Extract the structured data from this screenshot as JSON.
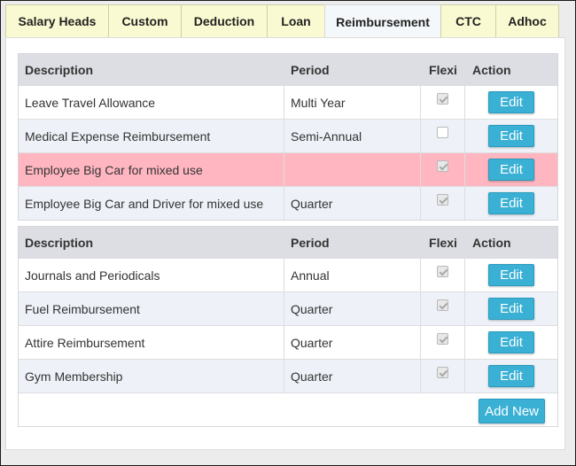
{
  "tabs": [
    {
      "label": "Salary Heads",
      "active": false
    },
    {
      "label": "Custom",
      "active": false
    },
    {
      "label": "Deduction",
      "active": false
    },
    {
      "label": "Loan",
      "active": false
    },
    {
      "label": "Reimbursement",
      "active": true
    },
    {
      "label": "CTC",
      "active": false
    },
    {
      "label": "Adhoc",
      "active": false
    }
  ],
  "tables": [
    {
      "headers": {
        "description": "Description",
        "period": "Period",
        "flexi": "Flexi",
        "action": "Action"
      },
      "rows": [
        {
          "description": "Leave Travel Allowance",
          "period": "Multi Year",
          "flexi": true,
          "action": "Edit",
          "highlight": false
        },
        {
          "description": "Medical Expense Reimbursement",
          "period": "Semi-Annual",
          "flexi": false,
          "action": "Edit",
          "highlight": false
        },
        {
          "description": "Employee Big Car for mixed use",
          "period": "",
          "flexi": true,
          "action": "Edit",
          "highlight": true
        },
        {
          "description": "Employee Big Car and Driver for mixed use",
          "period": "Quarter",
          "flexi": true,
          "action": "Edit",
          "highlight": false
        }
      ]
    },
    {
      "headers": {
        "description": "Description",
        "period": "Period",
        "flexi": "Flexi",
        "action": "Action"
      },
      "rows": [
        {
          "description": "Journals and Periodicals",
          "period": "Annual",
          "flexi": true,
          "action": "Edit",
          "highlight": false
        },
        {
          "description": "Fuel Reimbursement",
          "period": "Quarter",
          "flexi": true,
          "action": "Edit",
          "highlight": false
        },
        {
          "description": "Attire Reimbursement",
          "period": "Quarter",
          "flexi": true,
          "action": "Edit",
          "highlight": false
        },
        {
          "description": "Gym Membership",
          "period": "Quarter",
          "flexi": true,
          "action": "Edit",
          "highlight": false
        }
      ]
    }
  ],
  "add_new_label": "Add New",
  "colors": {
    "accent": "#3ab0d4",
    "highlight_row": "#ffb6c1",
    "tab_bg": "#fafad2",
    "header_bg": "#dcdee3"
  }
}
